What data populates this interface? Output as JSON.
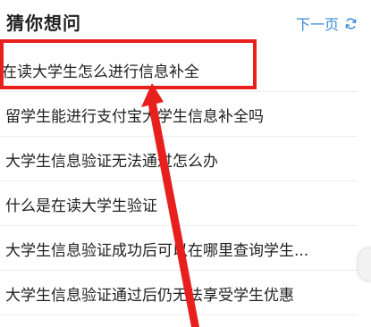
{
  "header": {
    "title": "猜你想问",
    "next_page_label": "下一页",
    "accent_color": "#3b8bdb"
  },
  "questions": [
    {
      "label": "在读大学生怎么进行信息补全"
    },
    {
      "label": "留学生能进行支付宝大学生信息补全吗"
    },
    {
      "label": "大学生信息验证无法通过怎么办"
    },
    {
      "label": "什么是在读大学生验证"
    },
    {
      "label": "大学生信息验证成功后可以在哪里查询学生..."
    },
    {
      "label": "大学生信息验证通过后仍无法享受学生优惠"
    }
  ],
  "annotation": {
    "highlight_color": "#e8201d"
  },
  "icons": {
    "refresh": "refresh-icon"
  }
}
